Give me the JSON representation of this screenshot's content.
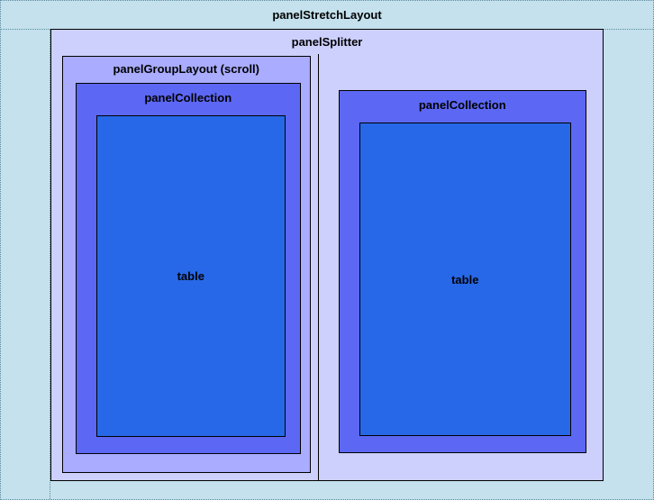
{
  "stretchLayout": {
    "title": "panelStretchLayout"
  },
  "splitter": {
    "title": "panelSplitter",
    "left": {
      "groupLayout": {
        "title": "panelGroupLayout (scroll)",
        "collection": {
          "title": "panelCollection",
          "table": {
            "label": "table"
          }
        }
      }
    },
    "right": {
      "collection": {
        "title": "panelCollection",
        "table": {
          "label": "table"
        }
      }
    }
  }
}
